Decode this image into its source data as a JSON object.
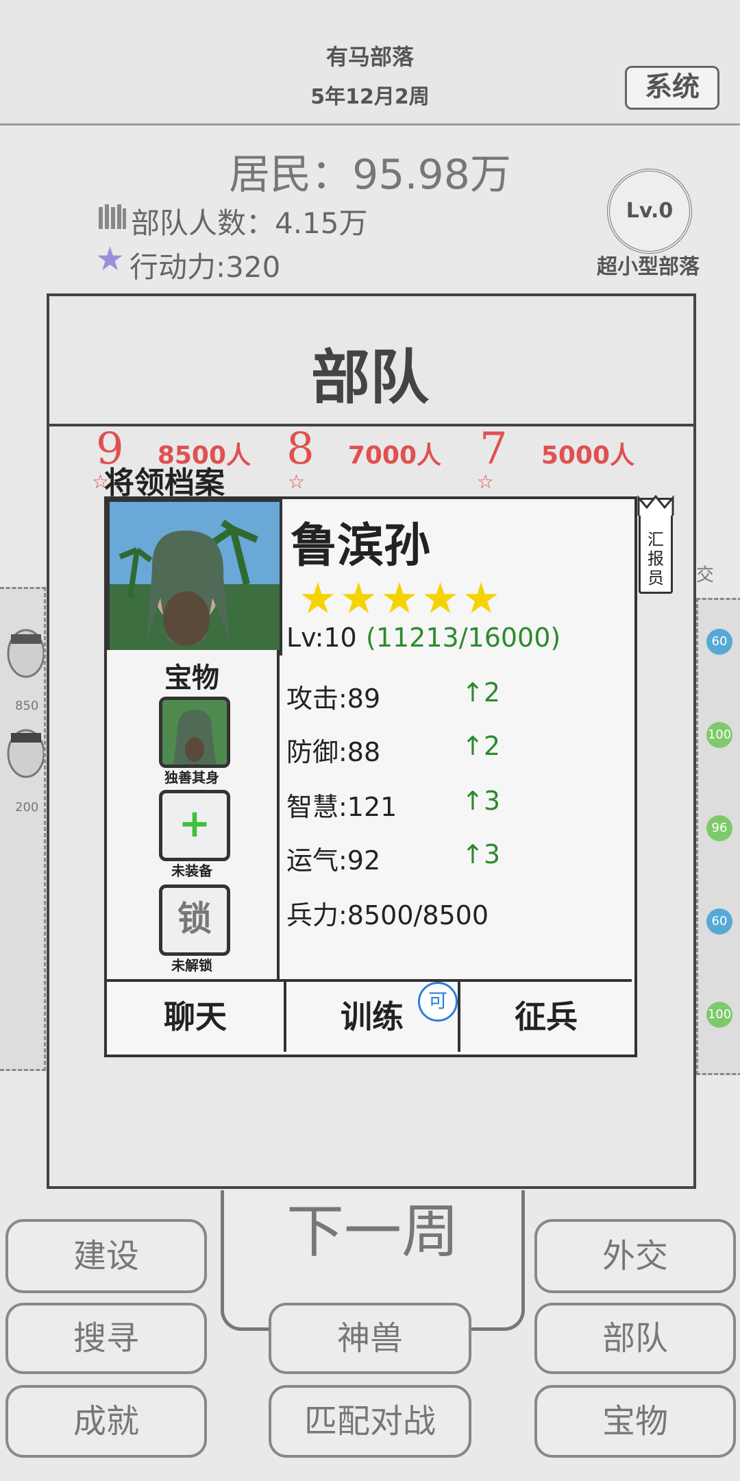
{
  "header": {
    "tribe_name": "有马部落",
    "date": "5年12月2周",
    "system_label": "系统"
  },
  "stats": {
    "residents": "居民：95.98万",
    "troops": "部队人数：4.15万",
    "action_points": "行动力:320",
    "level_badge": "Lv.0",
    "level_type": "超小型部落"
  },
  "troop_panel": {
    "title": "部队",
    "top_cards": [
      {
        "rank": "9",
        "men": "8500人"
      },
      {
        "rank": "8",
        "men": "7000人"
      },
      {
        "rank": "7",
        "men": "5000人"
      }
    ]
  },
  "left_strip": {
    "numbers": [
      "850",
      "200"
    ]
  },
  "right_strip": {
    "levels": [
      {
        "value": "60",
        "color": "#56a9d6"
      },
      {
        "value": "100",
        "color": "#7dc96b"
      },
      {
        "value": "96",
        "color": "#7dc96b"
      },
      {
        "value": "60",
        "color": "#56a9d6"
      },
      {
        "value": "100",
        "color": "#7dc96b"
      }
    ],
    "edge_label": "交"
  },
  "general": {
    "dialog_title": "将领档案",
    "name": "鲁滨孙",
    "stars_display": "★★★★★",
    "star_count": 5,
    "level": "Lv:10",
    "exp": "(11213/16000)",
    "treasure_title": "宝物",
    "slots": [
      {
        "label": "独善其身",
        "icon": "portrait-icon"
      },
      {
        "label": "未装备",
        "symbol": "+"
      },
      {
        "label": "未解锁",
        "symbol": "锁"
      }
    ],
    "stats": [
      {
        "label": "攻击:89",
        "gain": "↑2"
      },
      {
        "label": "防御:88",
        "gain": "↑2"
      },
      {
        "label": "智慧:121",
        "gain": "↑3"
      },
      {
        "label": "运气:92",
        "gain": "↑3"
      }
    ],
    "troops": "兵力:8500/8500",
    "reporter_label": "汇报员",
    "actions": {
      "chat": "聊天",
      "train": "训练",
      "recruit": "征兵",
      "available_badge": "可"
    }
  },
  "bottom_menu": {
    "next_week": "下一周",
    "build": "建设",
    "diplomacy": "外交",
    "search": "搜寻",
    "beasts": "神兽",
    "troops": "部队",
    "achievements": "成就",
    "match_battle": "匹配对战",
    "treasure": "宝物"
  }
}
